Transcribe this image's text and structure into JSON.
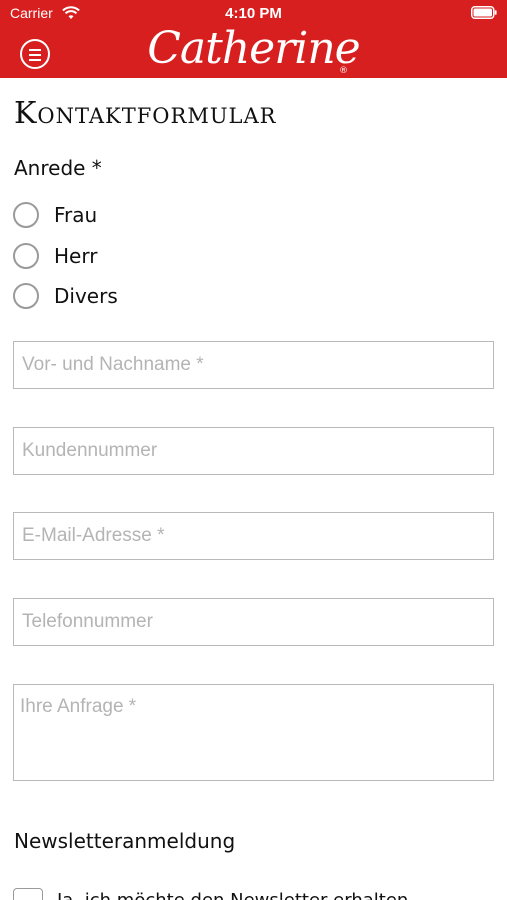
{
  "status_bar": {
    "carrier": "Carrier",
    "time": "4:10 PM"
  },
  "header": {
    "brand": "Catherine",
    "registered_mark": "®",
    "background_color": "#d81f1f",
    "menu_icon": "menu-icon"
  },
  "form": {
    "title": "Kontaktformular",
    "salutation": {
      "label": "Anrede *",
      "options": [
        "Frau",
        "Herr",
        "Divers"
      ]
    },
    "fields": {
      "name_placeholder": "Vor- und Nachname *",
      "customer_number_placeholder": "Kundennummer",
      "email_placeholder": "E-Mail-Adresse *",
      "phone_placeholder": "Telefonnummer",
      "inquiry_placeholder": "Ihre Anfrage *"
    },
    "newsletter": {
      "heading": "Newsletteranmeldung",
      "checkbox_text": "Ja, ich möchte den Newsletter erhalten"
    }
  }
}
